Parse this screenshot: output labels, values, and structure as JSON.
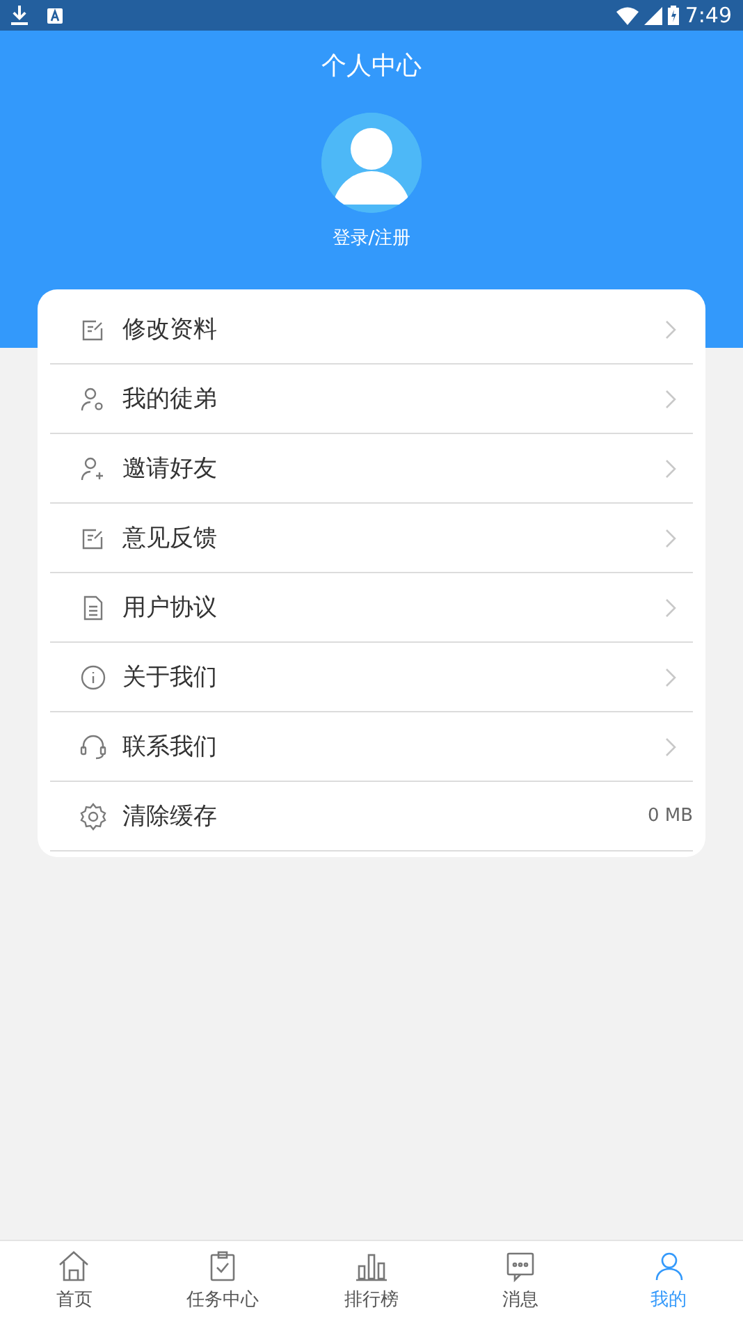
{
  "status_bar": {
    "time": "7:49"
  },
  "header": {
    "title": "个人中心",
    "login": "登录/注册"
  },
  "menu": [
    {
      "label": "修改资料",
      "kind": "link"
    },
    {
      "label": "我的徒弟",
      "kind": "link"
    },
    {
      "label": "邀请好友",
      "kind": "link"
    },
    {
      "label": "意见反馈",
      "kind": "link"
    },
    {
      "label": "用户协议",
      "kind": "link"
    },
    {
      "label": "关于我们",
      "kind": "link"
    },
    {
      "label": "联系我们",
      "kind": "link"
    },
    {
      "label": "清除缓存",
      "kind": "value",
      "value": "0 MB"
    }
  ],
  "tab_bar": [
    {
      "label": "首页",
      "selected": false
    },
    {
      "label": "任务中心",
      "selected": false
    },
    {
      "label": "排行榜",
      "selected": false
    },
    {
      "label": "消息",
      "selected": false
    },
    {
      "label": "我的",
      "selected": true
    }
  ]
}
